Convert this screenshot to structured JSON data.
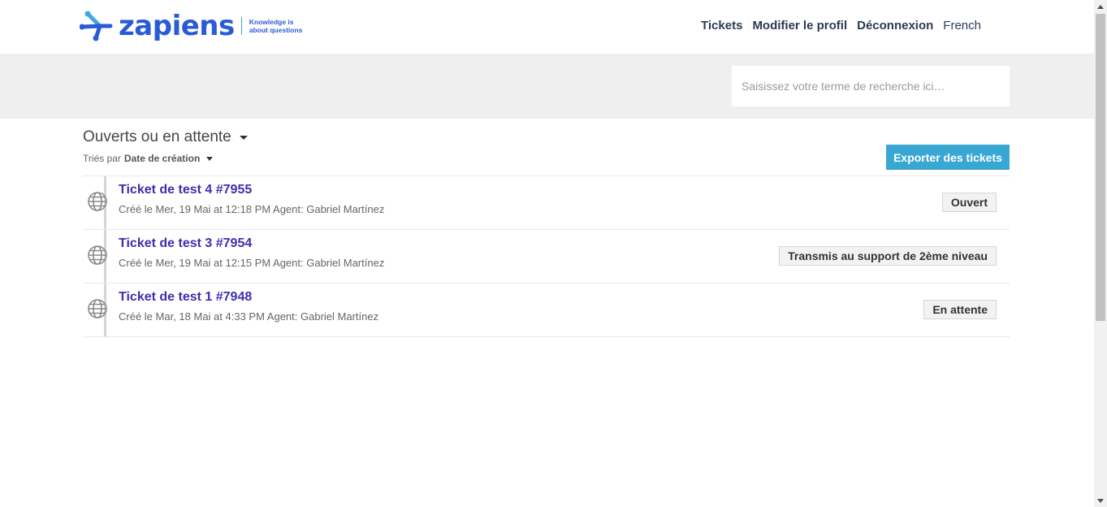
{
  "brand": {
    "name": "zapiens",
    "tagline_line1": "Knowledge is",
    "tagline_line2": "about questions",
    "color": "#2a5bd7"
  },
  "nav": {
    "tickets": "Tickets",
    "edit_profile": "Modifier le profil",
    "logout": "Déconnexion",
    "language": "French"
  },
  "search": {
    "placeholder": "Saisissez votre terme de recherche ici…"
  },
  "filter": {
    "label": "Ouverts ou en attente"
  },
  "sort": {
    "prefix": "Triés par",
    "value": "Date de création"
  },
  "export": {
    "label": "Exporter des tickets",
    "color": "#39a7d4"
  },
  "tickets": [
    {
      "title": "Ticket de test 4 #7955",
      "meta": "Créé le Mer, 19 Mai at 12:18 PM Agent: Gabriel Martínez",
      "status": "Ouvert"
    },
    {
      "title": "Ticket de test 3 #7954",
      "meta": "Créé le Mer, 19 Mai at 12:15 PM Agent: Gabriel Martínez",
      "status": "Transmis au support de 2ème niveau"
    },
    {
      "title": "Ticket de test 1 #7948",
      "meta": "Créé le Mar, 18 Mai at 4:33 PM Agent: Gabriel Martínez",
      "status": "En attente"
    }
  ],
  "icons": {
    "ticket": "globe-icon",
    "logo": "zapiens-logo-mark"
  }
}
